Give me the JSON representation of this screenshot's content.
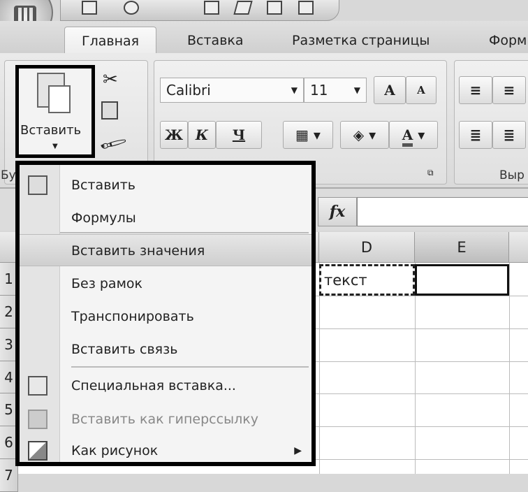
{
  "ribbon_tabs": [
    "Главная",
    "Вставка",
    "Разметка страницы",
    "Форм"
  ],
  "clipboard": {
    "paste_label": "Вставить",
    "group_label": "Бу"
  },
  "font": {
    "name": "Calibri",
    "size": "11",
    "bold": "Ж",
    "italic": "К",
    "underline": "Ч",
    "grow": "A",
    "shrink": "A",
    "color": "A"
  },
  "alignment": {
    "group_label": "Выр"
  },
  "formula_bar": {
    "fx": "fx",
    "value": ""
  },
  "columns": [
    "D",
    "E"
  ],
  "rows": [
    "1",
    "2",
    "3",
    "4",
    "5",
    "6",
    "7"
  ],
  "cells": {
    "D1": "текст",
    "E1": ""
  },
  "paste_menu": {
    "items": [
      {
        "label": "Вставить",
        "icon": "paste-icon"
      },
      {
        "label": "Формулы"
      },
      {
        "label": "Вставить значения",
        "highlighted": true
      },
      {
        "label": "Без рамок"
      },
      {
        "label": "Транспонировать"
      },
      {
        "label": "Вставить связь"
      },
      {
        "label": "Специальная вставка...",
        "icon": "paste-special-icon"
      },
      {
        "label": "Вставить как гиперссылку",
        "icon": "paste-hyperlink-icon",
        "disabled": true
      },
      {
        "label": "Как рисунок",
        "icon": "picture-icon",
        "submenu": true
      }
    ]
  }
}
